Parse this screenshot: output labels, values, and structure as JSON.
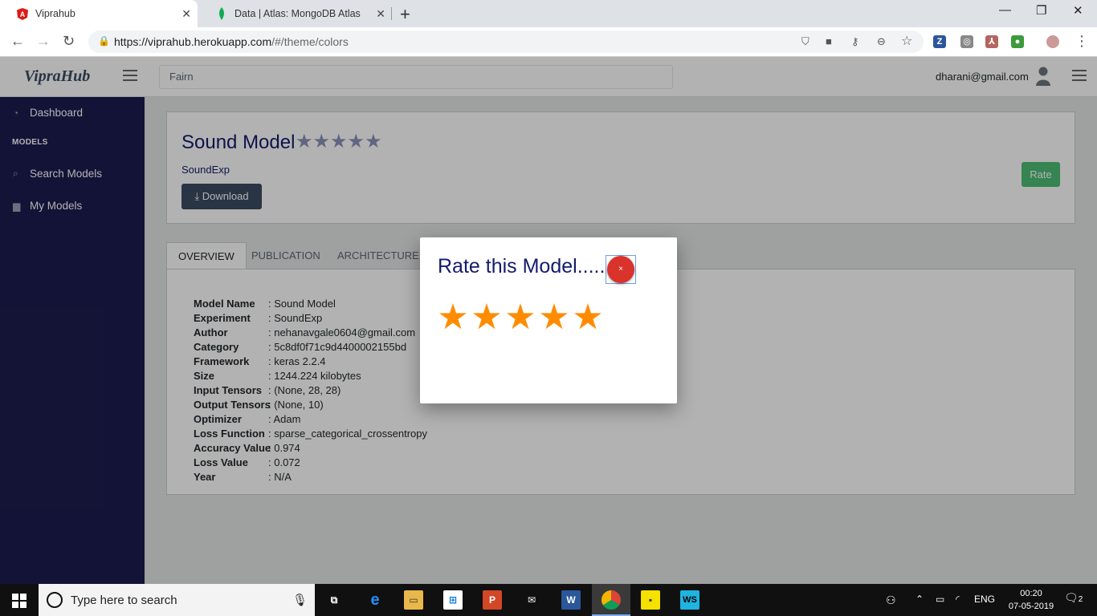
{
  "browser": {
    "tabs": [
      {
        "title": "Viprahub",
        "active": true
      },
      {
        "title": "Data | Atlas: MongoDB Atlas",
        "active": false
      }
    ],
    "url_host": "https://viprahub.herokuapp.com",
    "url_path": "/#/theme/colors"
  },
  "header": {
    "brand": "VipraHub",
    "search_value": "Fairn",
    "user_email": "dharani@gmail.com"
  },
  "sidebar": {
    "items": [
      {
        "label": "Dashboard",
        "icon": "speedometer-icon"
      },
      {
        "label": "Search Models",
        "icon": "search-icon"
      },
      {
        "label": "My Models",
        "icon": "folder-icon"
      }
    ],
    "section_title": "MODELS"
  },
  "model": {
    "name": "Sound Model",
    "experiment": "SoundExp",
    "download_label": "Download",
    "rate_label": "Rate",
    "rating": 0
  },
  "tabs": [
    "OVERVIEW",
    "PUBLICATION",
    "ARCHITECTURE"
  ],
  "details": [
    {
      "k": "Model Name",
      "v": ": Sound Model"
    },
    {
      "k": "Experiment",
      "v": ": SoundExp"
    },
    {
      "k": "Author",
      "v": ": nehanavgale0604@gmail.com"
    },
    {
      "k": "Category",
      "v": ": 5c8df0f71c9d4400002155bd"
    },
    {
      "k": "Framework",
      "v": ": keras 2.2.4"
    },
    {
      "k": "Size",
      "v": ": 1244.224 kilobytes"
    },
    {
      "k": "Input Tensors",
      "v": ": (None, 28, 28)"
    },
    {
      "k": "Output Tensors",
      "v": ": (None, 10)"
    },
    {
      "k": "Optimizer",
      "v": ": Adam"
    },
    {
      "k": "Loss Function",
      "v": ": sparse_categorical_crossentropy"
    },
    {
      "k": "Accuracy Value",
      "v": ": 0.974"
    },
    {
      "k": "Loss Value",
      "v": ": 0.072"
    },
    {
      "k": "Year",
      "v": ": N/A"
    }
  ],
  "modal": {
    "title": "Rate this Model.....",
    "close": "×",
    "stars": 5,
    "star_color": "#ff8c00"
  },
  "taskbar": {
    "search_placeholder": "Type here to search",
    "lang": "ENG",
    "time": "00:20",
    "date": "07-05-2019",
    "notifications": "2"
  },
  "colors": {
    "sidebar": "#1c1c4f",
    "title": "#151b6b",
    "rate_button": "#4dbd74",
    "close_button": "#d9332c"
  }
}
